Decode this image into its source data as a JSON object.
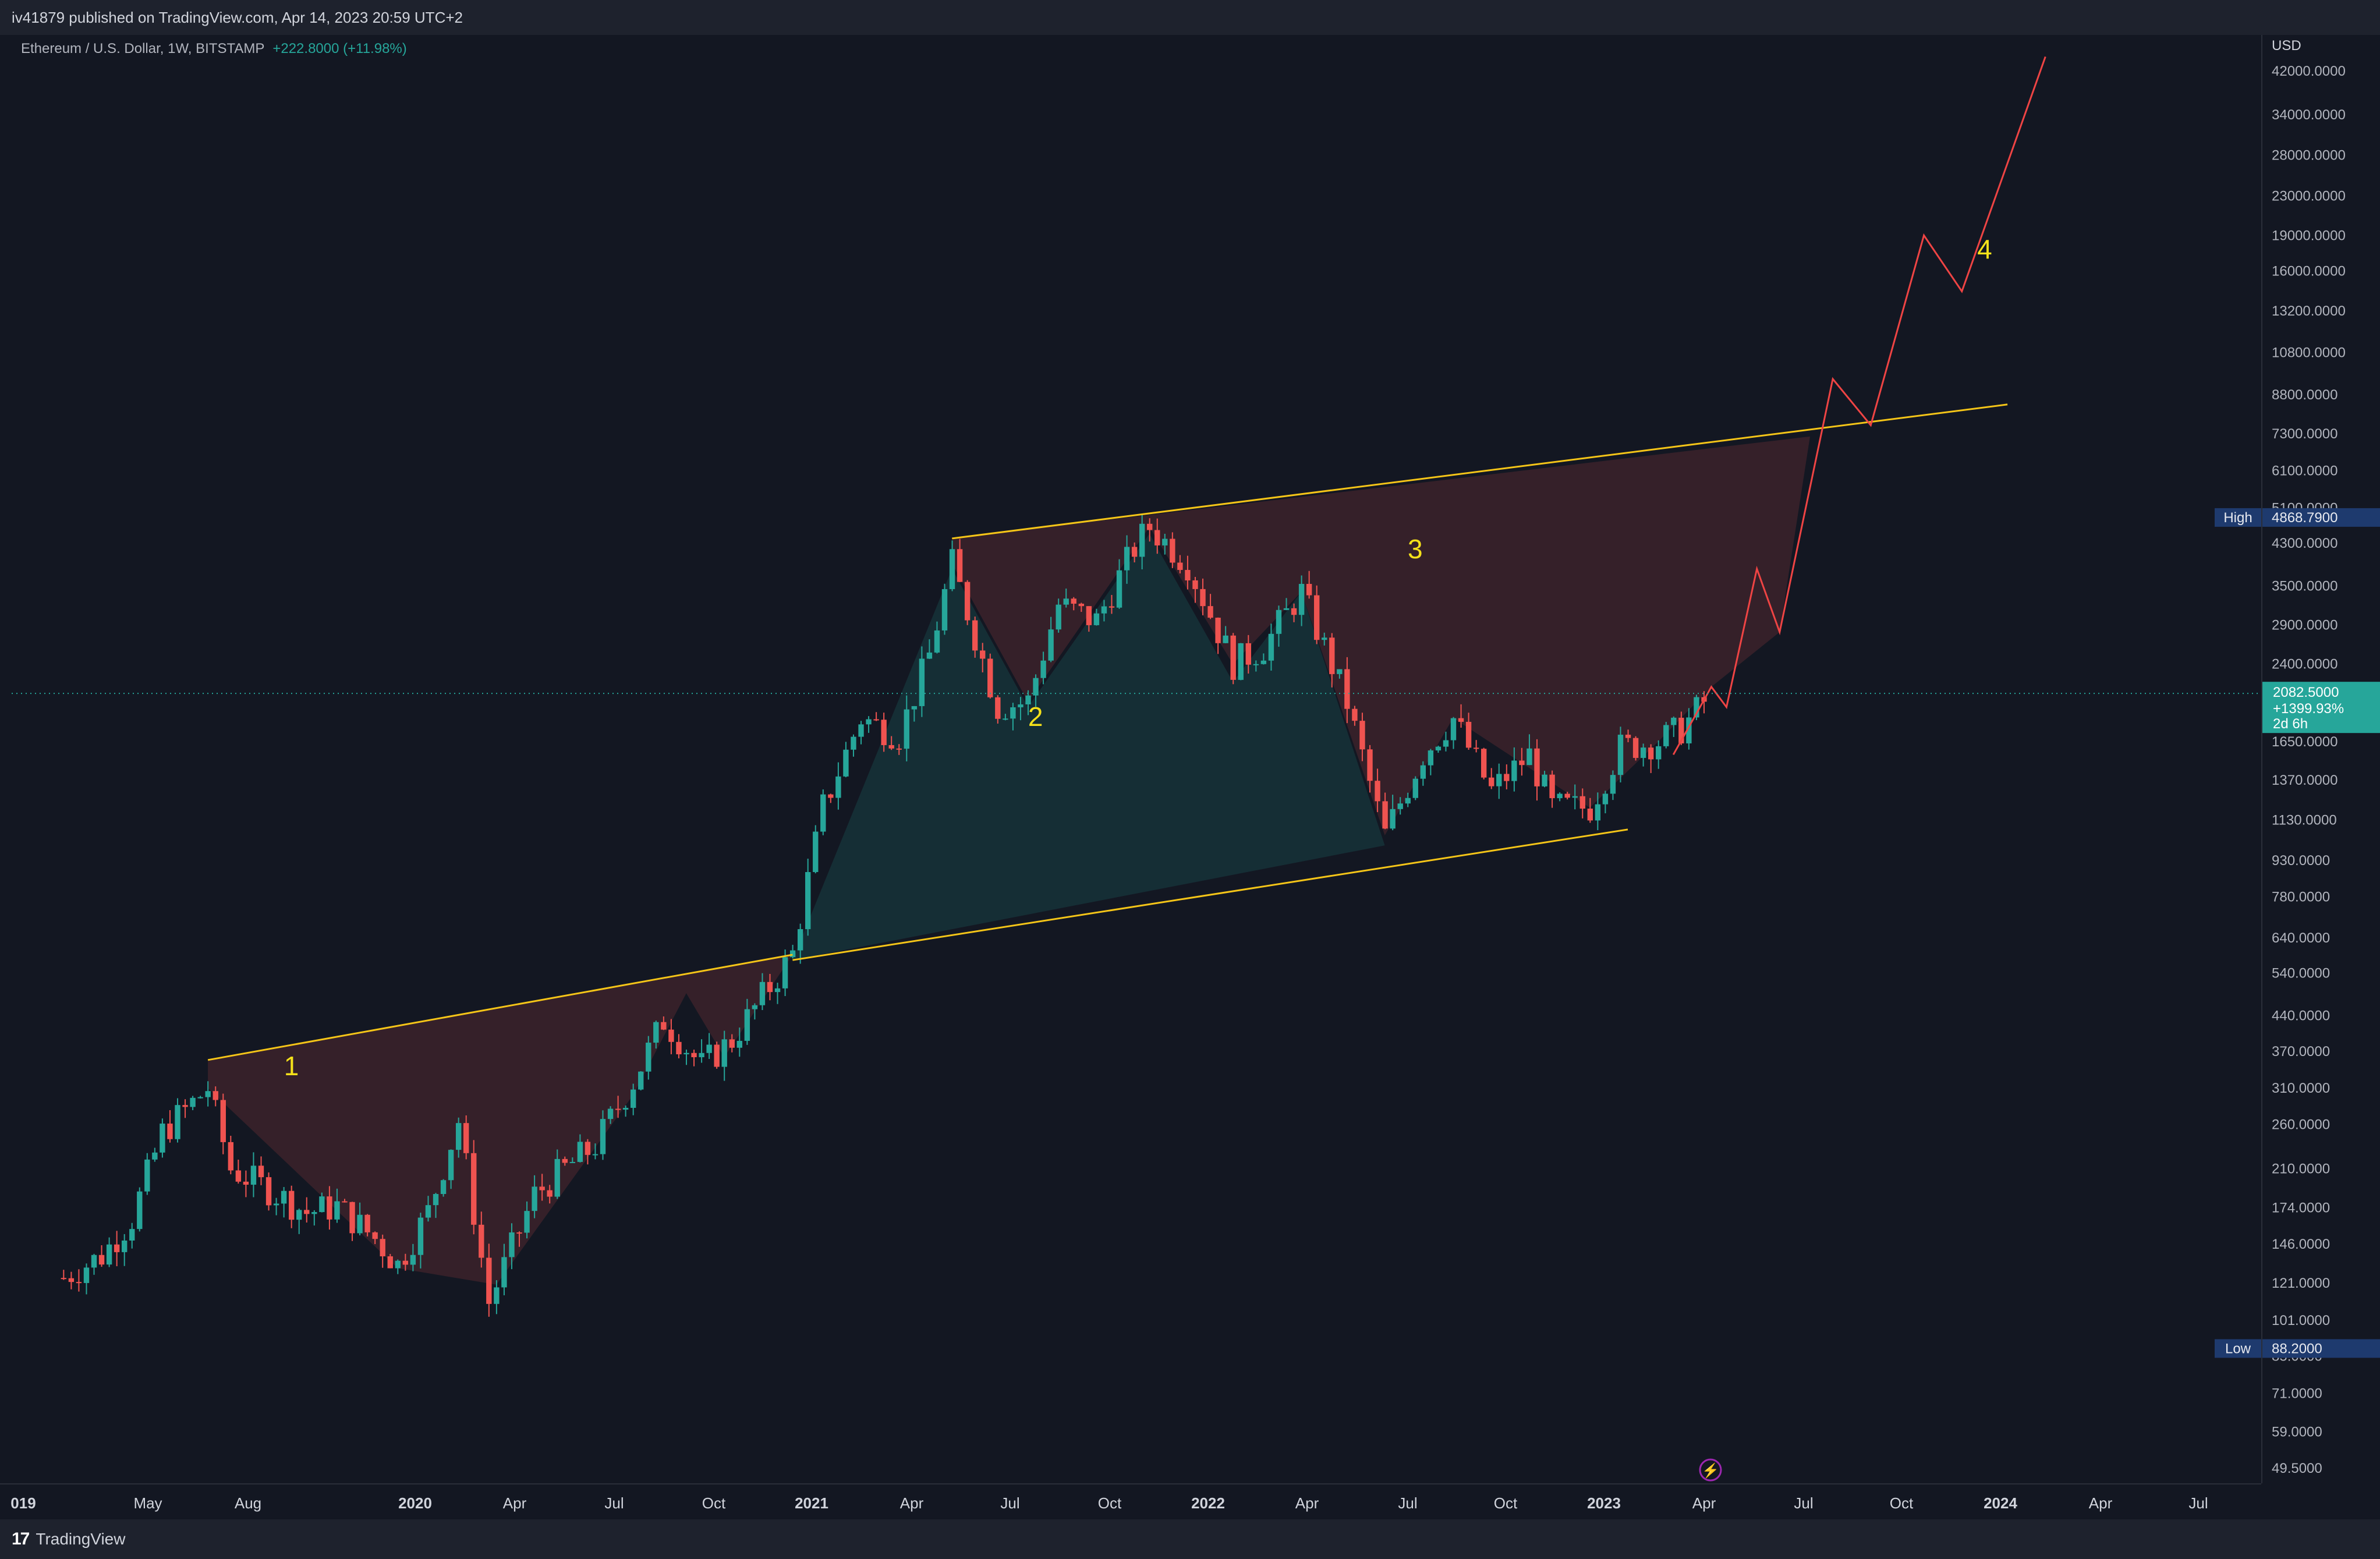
{
  "header": {
    "published": "iv41879 published on TradingView.com, Apr 14, 2023 20:59 UTC+2"
  },
  "legend": {
    "symbol": "Ethereum / U.S. Dollar, 1W, BITSTAMP",
    "change": "+222.8000 (+11.98%)"
  },
  "footer": {
    "brand": "TradingView"
  },
  "colors": {
    "up": "#26a69a",
    "down": "#ef5350",
    "trendline": "#f5c518",
    "projection": "#ef4444",
    "annotation": "#f5e11a",
    "background": "#131722"
  },
  "price_scale": {
    "currency": "USD",
    "ticks": [
      "42000.0000",
      "34000.0000",
      "28000.0000",
      "23000.0000",
      "19000.0000",
      "16000.0000",
      "13200.0000",
      "10800.0000",
      "8800.0000",
      "7300.0000",
      "6100.0000",
      "5100.0000",
      "4300.0000",
      "3500.0000",
      "2900.0000",
      "2400.0000",
      "1650.0000",
      "1370.0000",
      "1130.0000",
      "930.0000",
      "780.0000",
      "640.0000",
      "540.0000",
      "440.0000",
      "370.0000",
      "310.0000",
      "260.0000",
      "210.0000",
      "174.0000",
      "146.0000",
      "121.0000",
      "101.0000",
      "85.0000",
      "71.0000",
      "59.0000",
      "49.5000"
    ],
    "high_label": "High",
    "high_value": "4868.7900",
    "low_label": "Low",
    "low_value": "88.2000",
    "last_price": "2082.5000",
    "last_change": "+1399.93%",
    "countdown": "2d 6h"
  },
  "time_scale": {
    "labels": [
      {
        "text": "019",
        "bold": true
      },
      {
        "text": "May",
        "bold": false
      },
      {
        "text": "Aug",
        "bold": false
      },
      {
        "text": "2020",
        "bold": true
      },
      {
        "text": "Apr",
        "bold": false
      },
      {
        "text": "Jul",
        "bold": false
      },
      {
        "text": "Oct",
        "bold": false
      },
      {
        "text": "2021",
        "bold": true
      },
      {
        "text": "Apr",
        "bold": false
      },
      {
        "text": "Jul",
        "bold": false
      },
      {
        "text": "Oct",
        "bold": false
      },
      {
        "text": "2022",
        "bold": true
      },
      {
        "text": "Apr",
        "bold": false
      },
      {
        "text": "Jul",
        "bold": false
      },
      {
        "text": "Oct",
        "bold": false
      },
      {
        "text": "2023",
        "bold": true
      },
      {
        "text": "Apr",
        "bold": false
      },
      {
        "text": "Jul",
        "bold": false
      },
      {
        "text": "Oct",
        "bold": false
      },
      {
        "text": "2024",
        "bold": true
      },
      {
        "text": "Apr",
        "bold": false
      },
      {
        "text": "Jul",
        "bold": false
      }
    ]
  },
  "annotations": [
    "1",
    "2",
    "3",
    "4"
  ],
  "chart_data": {
    "type": "candlestick",
    "symbol": "ETH/USD",
    "interval": "1W",
    "scale": "log",
    "ylim": [
      49.5,
      42000
    ],
    "series": [
      {
        "date": "2019-02-11",
        "close": 124
      },
      {
        "date": "2019-03-18",
        "close": 138
      },
      {
        "date": "2019-04-15",
        "close": 165
      },
      {
        "date": "2019-05-13",
        "close": 250
      },
      {
        "date": "2019-06-24",
        "close": 310
      },
      {
        "date": "2019-07-15",
        "close": 210
      },
      {
        "date": "2019-08-19",
        "close": 190
      },
      {
        "date": "2019-09-23",
        "close": 170
      },
      {
        "date": "2019-10-21",
        "close": 175
      },
      {
        "date": "2019-11-25",
        "close": 150
      },
      {
        "date": "2019-12-16",
        "close": 132
      },
      {
        "date": "2020-01-13",
        "close": 170
      },
      {
        "date": "2020-02-10",
        "close": 265
      },
      {
        "date": "2020-03-09",
        "close": 110
      },
      {
        "date": "2020-04-20",
        "close": 185
      },
      {
        "date": "2020-05-18",
        "close": 210
      },
      {
        "date": "2020-06-15",
        "close": 235
      },
      {
        "date": "2020-07-20",
        "close": 320
      },
      {
        "date": "2020-08-17",
        "close": 430
      },
      {
        "date": "2020-09-21",
        "close": 345
      },
      {
        "date": "2020-10-19",
        "close": 390
      },
      {
        "date": "2020-11-16",
        "close": 480
      },
      {
        "date": "2020-12-14",
        "close": 590
      },
      {
        "date": "2021-01-11",
        "close": 1200
      },
      {
        "date": "2021-02-15",
        "close": 1850
      },
      {
        "date": "2021-03-22",
        "close": 1700
      },
      {
        "date": "2021-04-19",
        "close": 2500
      },
      {
        "date": "2021-05-10",
        "close": 3900
      },
      {
        "date": "2021-06-21",
        "close": 1950
      },
      {
        "date": "2021-07-19",
        "close": 2000
      },
      {
        "date": "2021-08-16",
        "close": 3200
      },
      {
        "date": "2021-09-20",
        "close": 2950
      },
      {
        "date": "2021-10-25",
        "close": 4200
      },
      {
        "date": "2021-11-08",
        "close": 4650
      },
      {
        "date": "2021-12-13",
        "close": 3900
      },
      {
        "date": "2022-01-24",
        "close": 2400
      },
      {
        "date": "2022-02-21",
        "close": 2600
      },
      {
        "date": "2022-03-28",
        "close": 3400
      },
      {
        "date": "2022-05-09",
        "close": 2000
      },
      {
        "date": "2022-06-13",
        "close": 1050
      },
      {
        "date": "2022-07-18",
        "close": 1550
      },
      {
        "date": "2022-08-15",
        "close": 1850
      },
      {
        "date": "2022-09-19",
        "close": 1300
      },
      {
        "date": "2022-10-24",
        "close": 1550
      },
      {
        "date": "2022-11-14",
        "close": 1200
      },
      {
        "date": "2022-12-19",
        "close": 1200
      },
      {
        "date": "2023-01-16",
        "close": 1600
      },
      {
        "date": "2023-02-20",
        "close": 1650
      },
      {
        "date": "2023-03-13",
        "close": 1750
      },
      {
        "date": "2023-04-10",
        "close": 2082.5
      }
    ],
    "projection": [
      {
        "date": "2023-03-06",
        "price": 1550
      },
      {
        "date": "2023-04-10",
        "price": 2150
      },
      {
        "date": "2023-04-24",
        "price": 1950
      },
      {
        "date": "2023-05-22",
        "price": 3800
      },
      {
        "date": "2023-06-12",
        "price": 2800
      },
      {
        "date": "2023-07-31",
        "price": 9500
      },
      {
        "date": "2023-09-04",
        "price": 7600
      },
      {
        "date": "2023-10-23",
        "price": 19000
      },
      {
        "date": "2023-11-27",
        "price": 14500
      },
      {
        "date": "2024-02-12",
        "price": 45000
      }
    ],
    "trendlines": [
      {
        "from": {
          "date": "2019-06-24",
          "price": 355
        },
        "to": {
          "date": "2020-12-14",
          "price": 590
        }
      },
      {
        "from": {
          "date": "2020-12-14",
          "price": 575
        },
        "to": {
          "date": "2023-01-23",
          "price": 1080
        }
      },
      {
        "from": {
          "date": "2021-05-10",
          "price": 4400
        },
        "to": {
          "date": "2024-01-08",
          "price": 8400
        }
      }
    ]
  }
}
